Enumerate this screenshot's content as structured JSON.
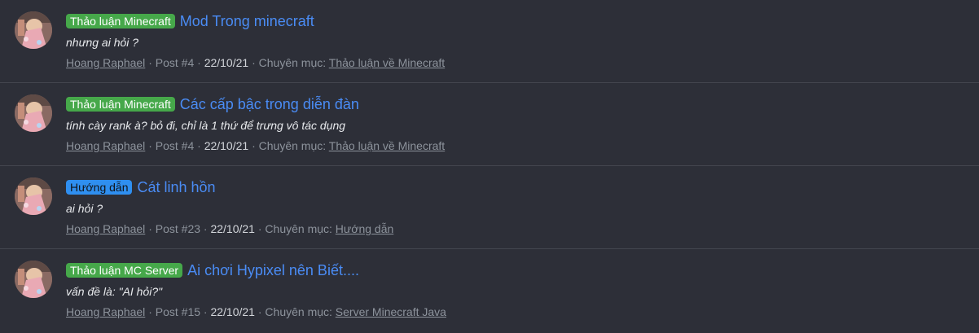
{
  "results": [
    {
      "prefix": "Thảo luận Minecraft",
      "prefix_color": "#46a84a",
      "title": "Mod Trong minecraft",
      "snippet": "nhưng ai hỏi ?",
      "author": "Hoang Raphael",
      "post": "Post #4",
      "date": "22/10/21",
      "category_label": "Chuyên mục:",
      "category": "Thảo luận về Minecraft"
    },
    {
      "prefix": "Thảo luận Minecraft",
      "prefix_color": "#46a84a",
      "title": "Các cấp bậc trong diễn đàn",
      "snippet": "tính cày rank à? bỏ đi, chỉ là 1 thứ để trưng vô tác dụng",
      "author": "Hoang Raphael",
      "post": "Post #4",
      "date": "22/10/21",
      "category_label": "Chuyên mục:",
      "category": "Thảo luận về Minecraft"
    },
    {
      "prefix": "Hướng dẫn",
      "prefix_color": "#2f8ff0",
      "title": "Cát linh hồn",
      "snippet": "ai hỏi ?",
      "author": "Hoang Raphael",
      "post": "Post #23",
      "date": "22/10/21",
      "category_label": "Chuyên mục:",
      "category": "Hướng dẫn"
    },
    {
      "prefix": "Thảo luận MC Server",
      "prefix_color": "#46a84a",
      "title": "Ai chơi Hypixel nên Biết....",
      "snippet": "vấn đề là: \"AI hỏi?\"",
      "author": "Hoang Raphael",
      "post": "Post #15",
      "date": "22/10/21",
      "category_label": "Chuyên mục:",
      "category": "Server Minecraft Java"
    }
  ],
  "separator": "·",
  "icons": {
    "avatar": "user-avatar-image"
  }
}
